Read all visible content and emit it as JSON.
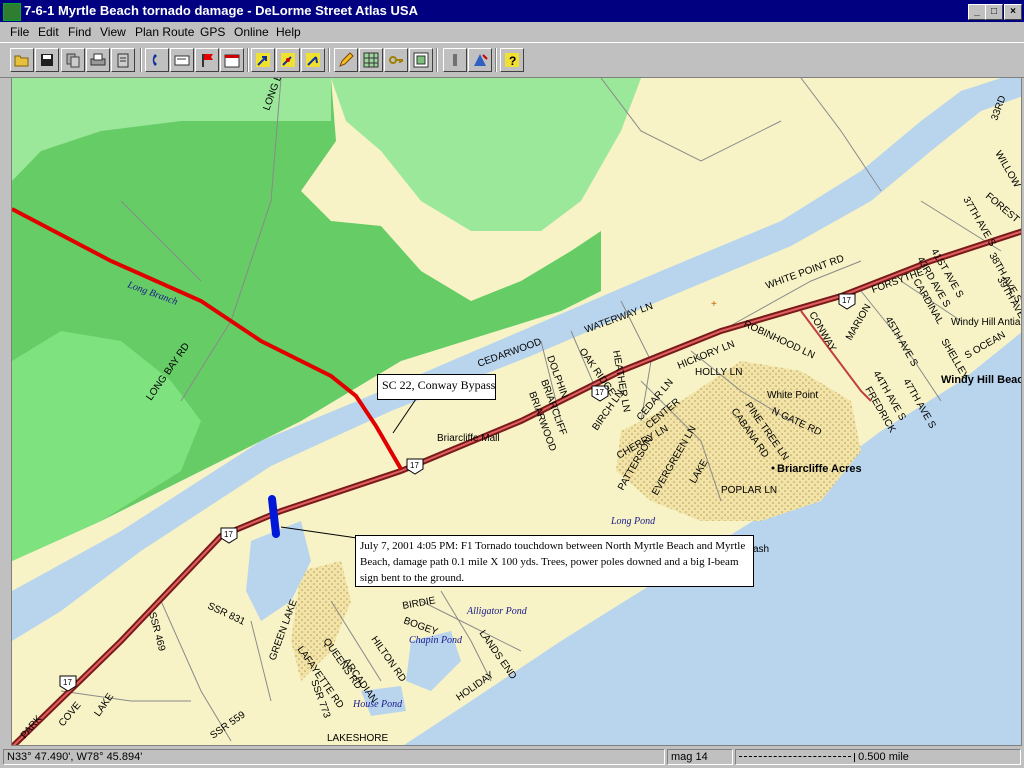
{
  "window": {
    "title": "7-6-1 Myrtle Beach tornado damage - DeLorme Street Atlas USA"
  },
  "menu": [
    "File",
    "Edit",
    "Find",
    "View",
    "Plan Route",
    "GPS",
    "Online",
    "Help"
  ],
  "toolbar": [
    {
      "icon": "open-folder-icon"
    },
    {
      "icon": "save-disk-icon"
    },
    {
      "icon": "copy-icon"
    },
    {
      "icon": "print-icon"
    },
    {
      "icon": "clipboard-icon"
    },
    {
      "icon": "phone-icon"
    },
    {
      "icon": "card-icon"
    },
    {
      "icon": "flag-icon"
    },
    {
      "icon": "calendar-icon"
    },
    {
      "icon": "route-start-icon"
    },
    {
      "icon": "route-via-icon"
    },
    {
      "icon": "route-end-icon"
    },
    {
      "icon": "pencil-icon"
    },
    {
      "icon": "map-grid-icon"
    },
    {
      "icon": "key-icon"
    },
    {
      "icon": "overview-map-icon"
    },
    {
      "icon": "info-icon"
    },
    {
      "icon": "gps-icon"
    },
    {
      "icon": "help-icon"
    }
  ],
  "map": {
    "callout_route": "SC 22, Conway Bypass",
    "callout_tornado": "July 7, 2001 4:05 PM: F1 Tornado touchdown between North Myrtle Beach and Myrtle Beach, damage path 0.1 mile X 100 yds. Trees, power poles downed and a big I-beam sign bent to the ground.",
    "shield": "17",
    "places": [
      "Briarcliffe Acres",
      "Windy Hill Beac",
      "White Point",
      "Briarcliffe Mall",
      "Windy Hill Antia",
      "ash"
    ],
    "water": [
      "Long Branch",
      "Long Pond",
      "Alligator Pond",
      "Chapin Pond",
      "House Pond"
    ],
    "roads": [
      "LONG BAY RD",
      "LONG B",
      "CEDARWOOD",
      "DOLPHIN",
      "BRIARCLIFF",
      "BRIARWOOD",
      "OAK RIDGE",
      "HEATHER LN",
      "WATERWAY LN",
      "WHITE POINT RD",
      "HICKORY LN",
      "HOLLY LN",
      "ROBINHOOD LN",
      "CONWAY",
      "MARION",
      "CARDINAL",
      "BIRCH LN",
      "CEDAR LN",
      "CENTER",
      "CHERRY LN",
      "PATTERSON",
      "EVERGREEN LN",
      "LAKE",
      "POPLAR LN",
      "CABANA RD",
      "PINE TREE LN",
      "N GATE RD",
      "FREDRICK",
      "44TH AVE S",
      "45TH AVE S",
      "47TH AVE S",
      "SHELLEY",
      "S OCEAN",
      "FORSYTHE",
      "41ST AVE S",
      "43RD AVE S",
      "37TH AVE S",
      "38TH AVE S",
      "39TH AVE S",
      "FOREST",
      "WILLOW",
      "33RD",
      "SSR 469",
      "SSR 831",
      "SSR 773",
      "SSR 559",
      "GREEN LAKE",
      "LAFAYETTE RD",
      "QUEENS RD",
      "ARCADIAN",
      "HILTON RD",
      "BIRDIE",
      "BOGEY",
      "LANDS END",
      "HOLIDAY",
      "LAKESHORE",
      "PARK",
      "COVE",
      "LAKE"
    ]
  },
  "status": {
    "coords": "N33° 47.490', W78° 45.894'",
    "mag": "mag 14",
    "scale": "0.500 mile"
  },
  "colors": {
    "titlebar": "#000080",
    "park": "#7ee27e",
    "park_dark": "#66cc66",
    "water": "#b9d5ee",
    "land": "#f7f3c6",
    "route": "#e00000",
    "tornado": "#0018d8"
  }
}
